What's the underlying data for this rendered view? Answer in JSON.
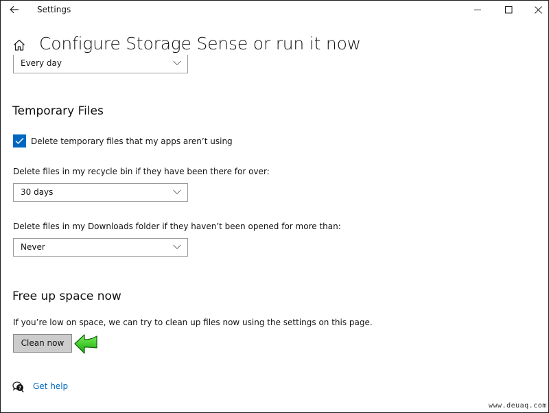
{
  "window": {
    "app_title": "Settings",
    "controls": {
      "minimize": "minimize-icon",
      "maximize": "maximize-icon",
      "close": "close-icon"
    },
    "back_icon": "arrow-left-icon"
  },
  "header": {
    "home_icon": "home-icon",
    "title": "Configure Storage Sense or run it now"
  },
  "run_storage_sense": {
    "selected": "Every day"
  },
  "temporary_files": {
    "heading": "Temporary Files",
    "checkbox_label": "Delete temporary files that my apps aren’t using",
    "checkbox_checked": true,
    "recycle_bin_label": "Delete files in my recycle bin if they have been there for over:",
    "recycle_bin_selected": "30 days",
    "downloads_label": "Delete files in my Downloads folder if they haven’t been opened for more than:",
    "downloads_selected": "Never"
  },
  "free_up": {
    "heading": "Free up space now",
    "description": "If you’re low on space, we can try to clean up files now using the settings on this page.",
    "button_label": "Clean now"
  },
  "help": {
    "icon": "help-chat-icon",
    "link_label": "Get help"
  },
  "annotation": {
    "arrow_icon": "green-arrow-icon",
    "arrow_color": "#2ecc1a"
  },
  "watermark": "www.deuaq.com",
  "colors": {
    "accent": "#0067c0",
    "button_bg": "#cccccc"
  }
}
